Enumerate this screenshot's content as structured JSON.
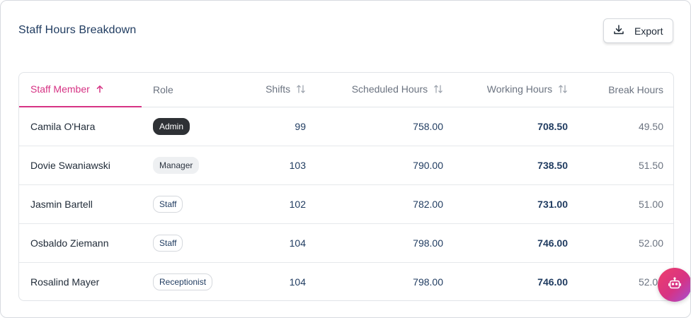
{
  "header": {
    "title": "Staff Hours Breakdown",
    "export_label": "Export"
  },
  "columns": {
    "staff_member": "Staff Member",
    "role": "Role",
    "shifts": "Shifts",
    "scheduled_hours": "Scheduled Hours",
    "working_hours": "Working Hours",
    "break_hours": "Break Hours"
  },
  "rows": [
    {
      "name": "Camila O'Hara",
      "role": "Admin",
      "shifts": "99",
      "scheduled": "758.00",
      "working": "708.50",
      "break": "49.50"
    },
    {
      "name": "Dovie Swaniawski",
      "role": "Manager",
      "shifts": "103",
      "scheduled": "790.00",
      "working": "738.50",
      "break": "51.50"
    },
    {
      "name": "Jasmin Bartell",
      "role": "Staff",
      "shifts": "102",
      "scheduled": "782.00",
      "working": "731.00",
      "break": "51.00"
    },
    {
      "name": "Osbaldo Ziemann",
      "role": "Staff",
      "shifts": "104",
      "scheduled": "798.00",
      "working": "746.00",
      "break": "52.00"
    },
    {
      "name": "Rosalind Mayer",
      "role": "Receptionist",
      "shifts": "104",
      "scheduled": "798.00",
      "working": "746.00",
      "break": "52.00"
    }
  ],
  "icons": {
    "export": "download-icon",
    "sort_active": "arrow-up-icon",
    "sort": "sort-arrows-icon",
    "fab": "bot-icon"
  },
  "colors": {
    "accent": "#d63384",
    "text_primary": "#1e3a5f",
    "muted": "#6b7380"
  }
}
